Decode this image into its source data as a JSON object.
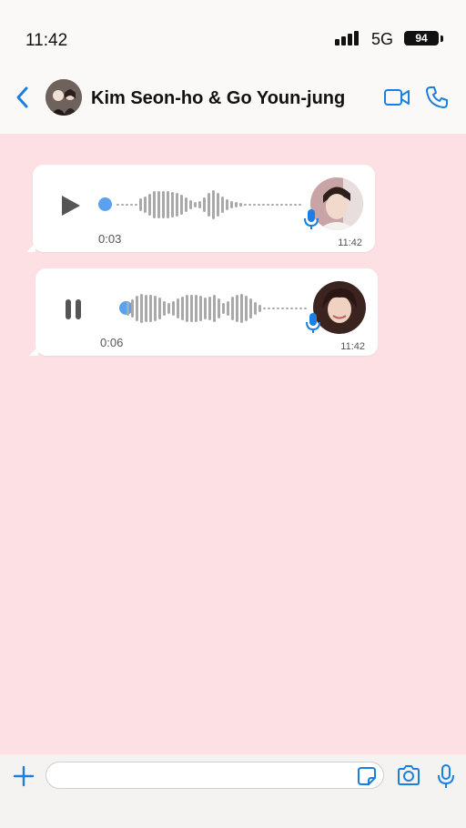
{
  "status": {
    "time": "11:42",
    "network": "5G",
    "battery": "94"
  },
  "header": {
    "title": "Kim Seon-ho & Go Youn-jung"
  },
  "messages": [
    {
      "state": "paused",
      "duration": "0:03",
      "time": "11:42",
      "sender_photo": "kim-seon-ho-photo"
    },
    {
      "state": "playing",
      "duration": "0:06",
      "time": "11:42",
      "sender_photo": "go-youn-jung-photo"
    }
  ],
  "composer": {
    "value": "",
    "placeholder": ""
  },
  "colors": {
    "accent": "#1a7fe0",
    "chat_background": "#fde0e3",
    "waveform": "#a9a9a9",
    "progress_dot": "#5aa2ef"
  },
  "icons": [
    "back-chevron-icon",
    "video-call-icon",
    "phone-icon",
    "play-icon",
    "pause-icon",
    "microphone-icon",
    "plus-icon",
    "sticker-icon",
    "camera-icon"
  ]
}
